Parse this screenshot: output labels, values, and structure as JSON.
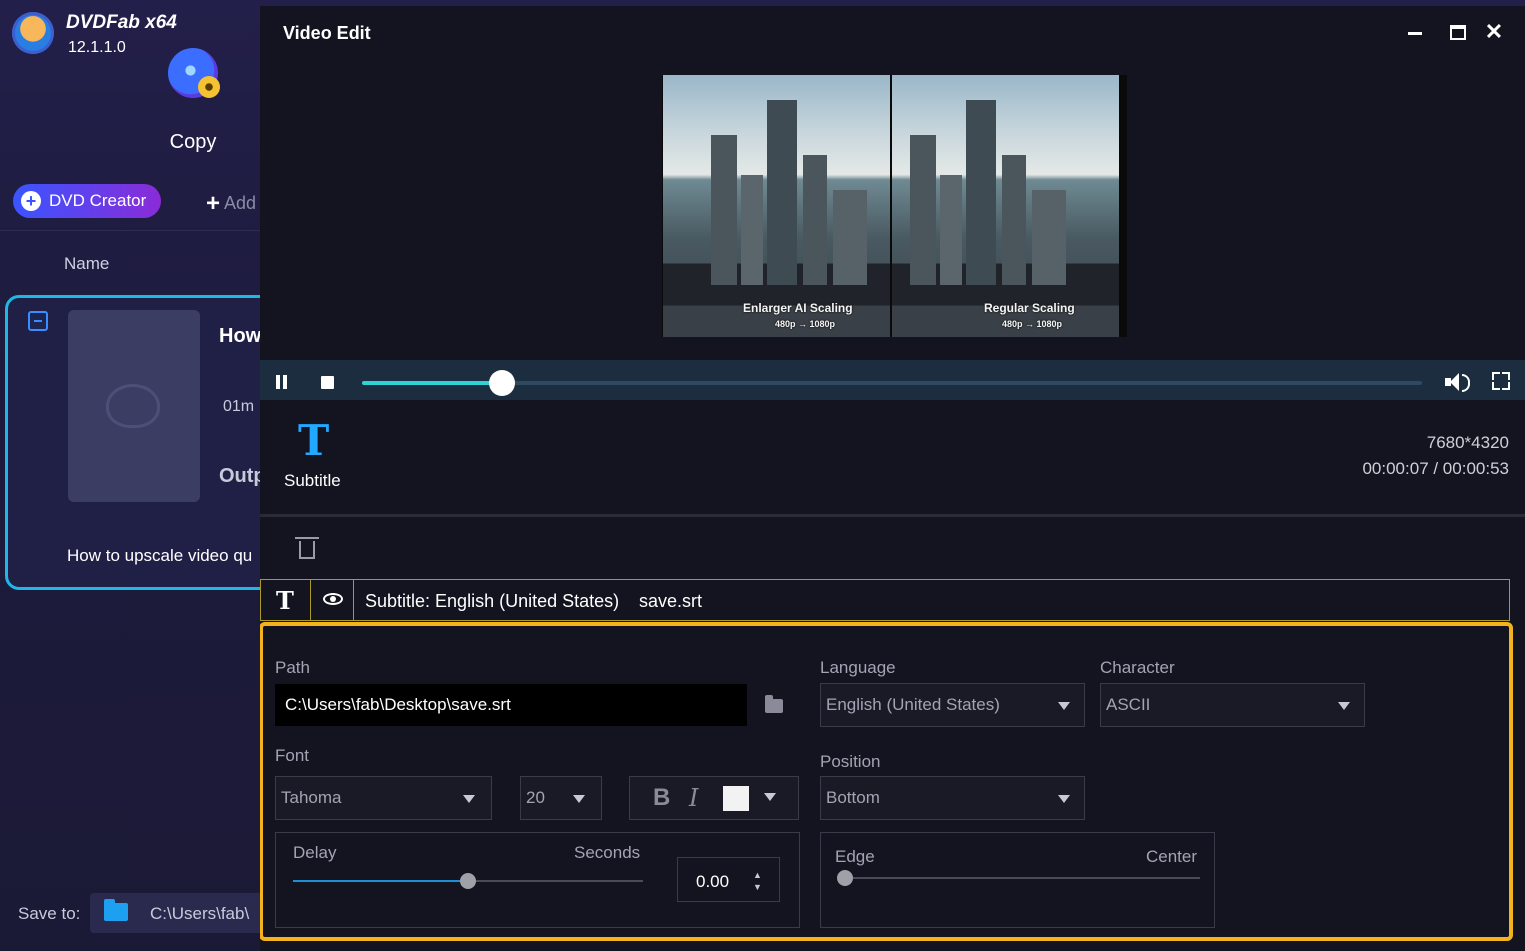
{
  "app": {
    "name": "DVDFab x64",
    "version": "12.1.1.0",
    "module_label": "Copy",
    "dvd_creator_label": "DVD Creator",
    "add_label": "Add",
    "name_column": "Name",
    "card_title": "How",
    "card_duration": "01m",
    "card_output": "Outp",
    "card_filename": "How to upscale video qu",
    "save_to_label": "Save to:",
    "save_to_path": "C:\\Users\\fab\\"
  },
  "dialog": {
    "title": "Video Edit",
    "minimize_icon": "minimize-icon",
    "maximize_icon": "maximize-icon",
    "close_glyph": "✕",
    "preview": {
      "left_label": "Enlarger AI Scaling",
      "left_sublabel": "480p → 1080p",
      "right_label": "Regular Scaling",
      "right_sublabel": "480p → 1080p"
    },
    "player": {
      "progress_fraction": 0.132,
      "accent_color": "#2fd3d6"
    },
    "tools": {
      "subtitle_icon_glyph": "T",
      "subtitle_label": "Subtitle"
    },
    "resolution": "7680*4320",
    "time": "00:00:07 / 00:00:53",
    "track": {
      "type_glyph": "T",
      "label": "Subtitle: English (United States)",
      "file": "save.srt"
    },
    "settings": {
      "path_label": "Path",
      "path_value": "C:\\Users\\fab\\Desktop\\save.srt",
      "language_label": "Language",
      "language_value": "English (United States)",
      "character_label": "Character",
      "character_value": "ASCII",
      "font_label": "Font",
      "font_value": "Tahoma",
      "size_value": "20",
      "bold_glyph": "B",
      "italic_glyph": "I",
      "text_color": "#f2f2f2",
      "position_label": "Position",
      "position_value": "Bottom",
      "delay_label": "Delay",
      "seconds_label": "Seconds",
      "delay_value": "0.00",
      "delay_slider_fraction": 0.5,
      "edge_label": "Edge",
      "center_label": "Center",
      "edge_slider_fraction": 0.0,
      "highlight_color": "#f4b31d"
    }
  }
}
